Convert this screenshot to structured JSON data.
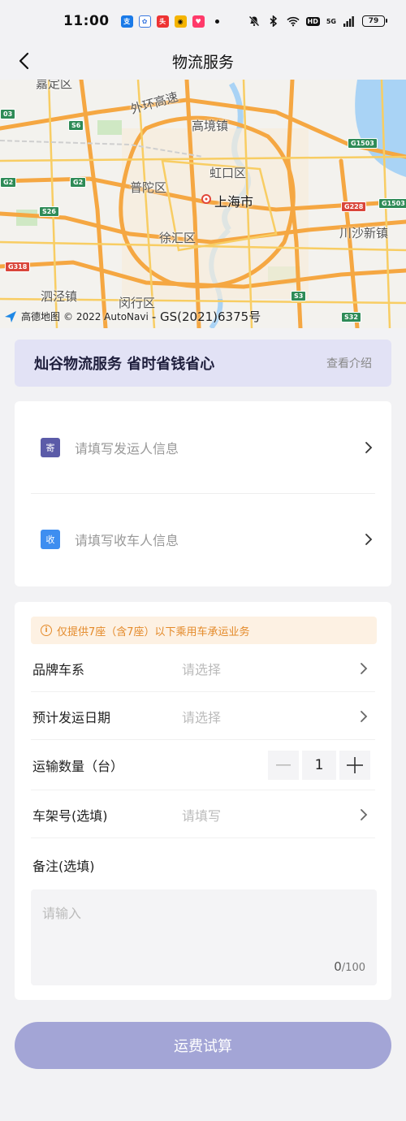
{
  "status_bar": {
    "time": "11:00",
    "battery": "79",
    "network": "5G",
    "hd": "HD"
  },
  "nav": {
    "title": "物流服务"
  },
  "map": {
    "labels": {
      "jiading": "嘉定区",
      "outer_ring": "外环高速",
      "gaojing": "高境镇",
      "hongkou": "虹口区",
      "putuo": "普陀区",
      "shanghai": "上海市",
      "xuhui": "徐汇区",
      "chuansha": "川沙新镇",
      "sijing": "泗泾镇",
      "minhang": "闵行区"
    },
    "roads": {
      "s6": "S6",
      "g2a": "G2",
      "g2b": "G2",
      "g1503a": "G1503",
      "g1503b": "G1503",
      "g228": "G228",
      "s26": "S26",
      "g318": "G318",
      "s3": "S3",
      "s32": "S32",
      "e3": "03"
    },
    "attribution": {
      "brand": "高德地图",
      "copyright": "© 2022 AutoNavi",
      "license": "- GS(2021)6375号"
    }
  },
  "banner": {
    "title": "灿谷物流服务 省时省钱省心",
    "link": "查看介绍"
  },
  "address": {
    "sender": {
      "tag": "寄",
      "placeholder": "请填写发运人信息"
    },
    "receiver": {
      "tag": "收",
      "placeholder": "请填写收车人信息"
    }
  },
  "form": {
    "notice": "仅提供7座（含7座）以下乘用车承运业务",
    "brand": {
      "label": "品牌车系",
      "placeholder": "请选择"
    },
    "date": {
      "label": "预计发运日期",
      "placeholder": "请选择"
    },
    "quantity": {
      "label": "运输数量（台）",
      "value": "1"
    },
    "vin": {
      "label": "车架号(选填)",
      "placeholder": "请填写"
    },
    "remark": {
      "label": "备注(选填)",
      "placeholder": "请输入",
      "count": "0",
      "max": "/100"
    }
  },
  "submit": {
    "label": "运费试算"
  },
  "colors": {
    "accent": "#a3a5d6",
    "banner_bg": "#e2e2f5",
    "notice_text": "#e48a2a",
    "sender_tag": "#5b5ba8",
    "receiver_tag": "#3e8ef0"
  }
}
